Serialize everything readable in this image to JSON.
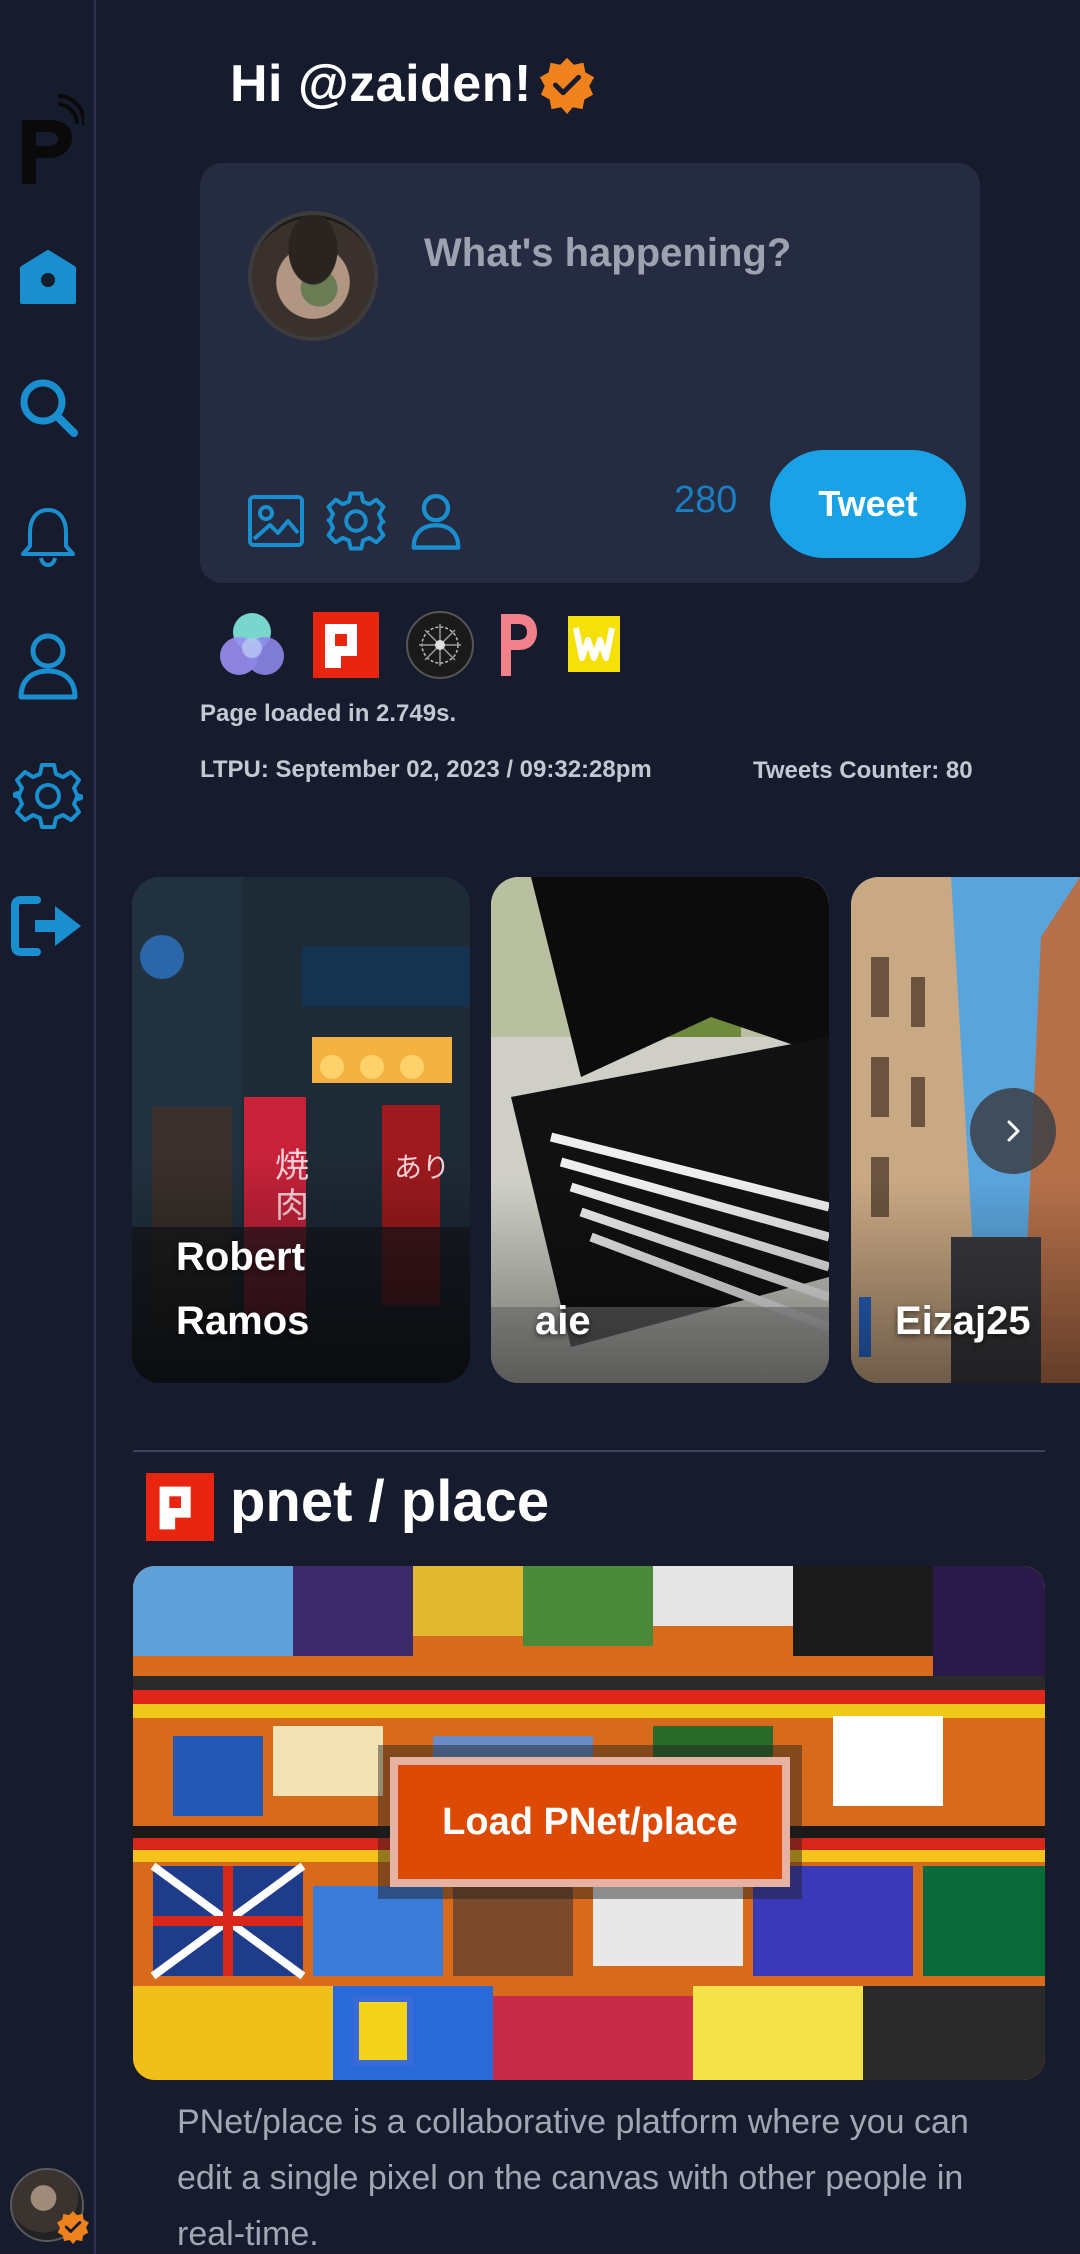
{
  "greeting": {
    "text": "Hi @zaiden!"
  },
  "composer": {
    "placeholder": "What's happening?",
    "char_count": "280",
    "tweet_label": "Tweet"
  },
  "sidebar": {
    "items": [
      {
        "name": "home",
        "icon": "home-icon"
      },
      {
        "name": "search",
        "icon": "search-icon"
      },
      {
        "name": "notifications",
        "icon": "bell-icon"
      },
      {
        "name": "profile",
        "icon": "user-icon"
      },
      {
        "name": "settings",
        "icon": "gear-icon"
      },
      {
        "name": "logout",
        "icon": "logout-icon"
      }
    ]
  },
  "info": {
    "loaded": "Page loaded in 2.749s.",
    "ltpu": "LTPU: September 02, 2023 / 09:32:28pm",
    "counter": "Tweets Counter: 80"
  },
  "stories": [
    {
      "name_line1": "Robert",
      "name_line2": "Ramos"
    },
    {
      "name_line1": "",
      "name_line2": "aie"
    },
    {
      "name_line1": "",
      "name_line2": "Eizaj25"
    }
  ],
  "place": {
    "title": "pnet / place",
    "load_label": "Load PNet/place",
    "description": "PNet/place is a collaborative platform where you can edit a single pixel on the canvas with other people in real-time."
  },
  "colors": {
    "background": "#161b2e",
    "accent": "#1aa2e6",
    "icon": "#1a8fd0",
    "card": "#252b40",
    "place_button": "#dd4a06",
    "verified_badge": "#f0821e"
  }
}
